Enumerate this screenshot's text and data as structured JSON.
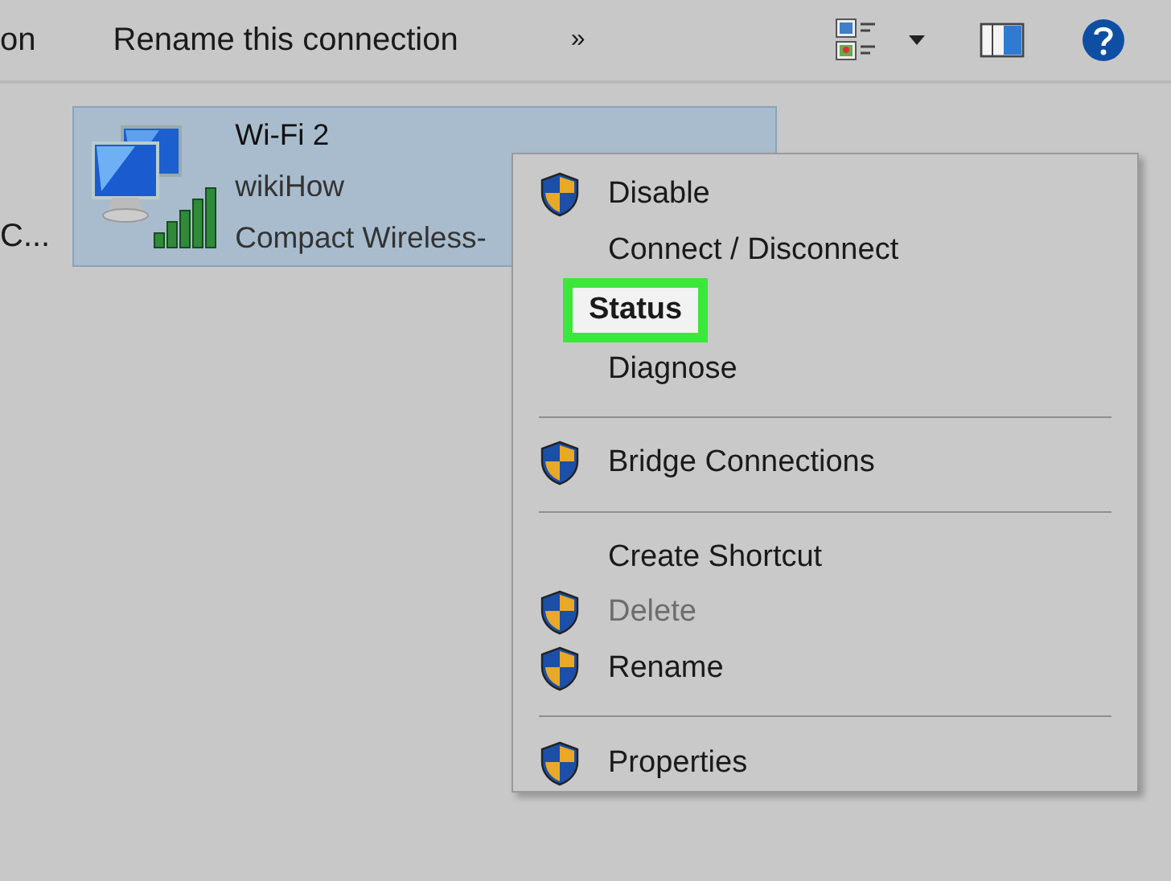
{
  "toolbar": {
    "items": [
      {
        "label": "on"
      },
      {
        "label": "Rename this connection"
      },
      {
        "label": "»"
      }
    ]
  },
  "connections": [
    {
      "lines": [
        "C..."
      ],
      "selected": false
    },
    {
      "lines": [
        "Wi-Fi 2",
        "wikiHow",
        "Compact Wireless-"
      ],
      "selected": true
    }
  ],
  "context_menu": {
    "items": [
      {
        "kind": "item",
        "label": "Disable",
        "shield": true,
        "disabled": false,
        "highlighted": false
      },
      {
        "kind": "item",
        "label": "Connect / Disconnect",
        "shield": false,
        "disabled": false,
        "highlighted": false
      },
      {
        "kind": "item",
        "label": "Status",
        "shield": false,
        "disabled": false,
        "highlighted": true
      },
      {
        "kind": "item",
        "label": "Diagnose",
        "shield": false,
        "disabled": false,
        "highlighted": false
      },
      {
        "kind": "separator"
      },
      {
        "kind": "item",
        "label": "Bridge Connections",
        "shield": true,
        "disabled": false,
        "highlighted": false
      },
      {
        "kind": "separator"
      },
      {
        "kind": "item",
        "label": "Create Shortcut",
        "shield": false,
        "disabled": false,
        "highlighted": false
      },
      {
        "kind": "item",
        "label": "Delete",
        "shield": true,
        "disabled": true,
        "highlighted": false
      },
      {
        "kind": "item",
        "label": "Rename",
        "shield": true,
        "disabled": false,
        "highlighted": false
      },
      {
        "kind": "separator"
      },
      {
        "kind": "item",
        "label": "Properties",
        "shield": true,
        "disabled": false,
        "highlighted": false
      }
    ]
  }
}
